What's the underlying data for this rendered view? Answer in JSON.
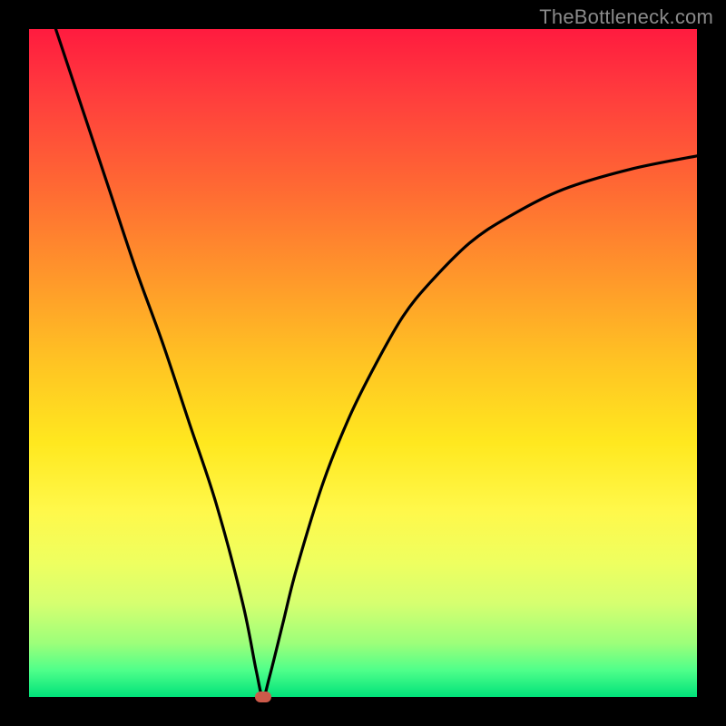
{
  "watermark": "TheBottleneck.com",
  "colors": {
    "curve": "#000000",
    "marker": "#cc5a4a",
    "frame": "#000000"
  },
  "chart_data": {
    "type": "line",
    "title": "",
    "xlabel": "",
    "ylabel": "",
    "xlim": [
      0,
      100
    ],
    "ylim": [
      0,
      100
    ],
    "minimum_marker": {
      "x": 35,
      "y": 0
    },
    "series": [
      {
        "name": "bottleneck-curve",
        "x": [
          4,
          8,
          12,
          16,
          20,
          24,
          28,
          32,
          34,
          35,
          36,
          38,
          40,
          44,
          48,
          52,
          56,
          60,
          66,
          72,
          80,
          90,
          100
        ],
        "y": [
          100,
          88,
          76,
          64,
          53,
          41,
          29,
          14,
          4,
          0,
          3,
          11,
          19,
          32,
          42,
          50,
          57,
          62,
          68,
          72,
          76,
          79,
          81
        ]
      }
    ]
  }
}
